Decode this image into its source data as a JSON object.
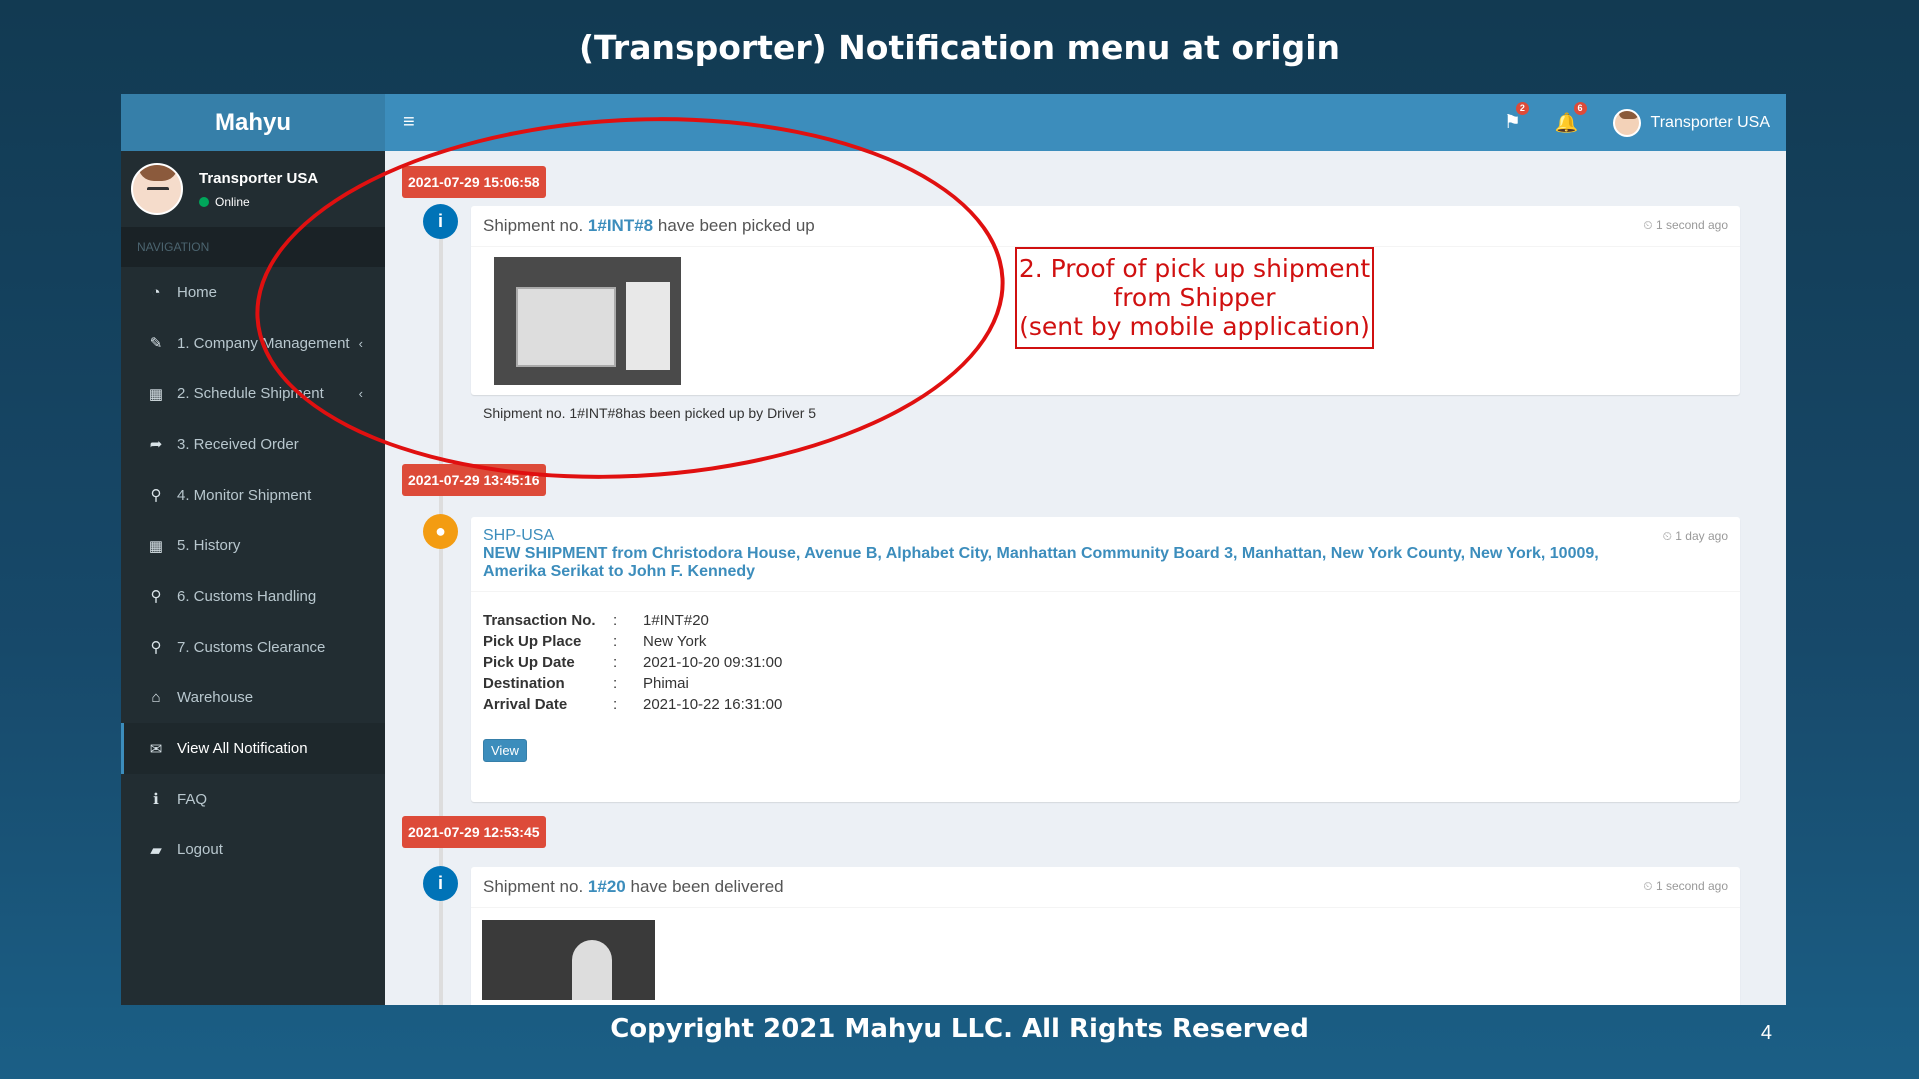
{
  "slide": {
    "title": "(Transporter) Notification menu at origin",
    "footer": "Copyright 2021 Mahyu LLC. All Rights Reserved",
    "page_number": "4"
  },
  "topbar": {
    "logo": "Mahyu",
    "flag_count": "2",
    "bell_count": "6",
    "user_name": "Transporter USA"
  },
  "sidebar": {
    "user_name": "Transporter USA",
    "status": "Online",
    "nav_header": "NAVIGATION",
    "items": [
      {
        "label": "Home",
        "icon": "dashboard-icon"
      },
      {
        "label": "1. Company Management",
        "icon": "edit-icon"
      },
      {
        "label": "2. Schedule Shipment",
        "icon": "calendar-icon"
      },
      {
        "label": "3. Received Order",
        "icon": "share-icon"
      },
      {
        "label": "4. Monitor Shipment",
        "icon": "search-icon"
      },
      {
        "label": "5. History",
        "icon": "calendar-icon"
      },
      {
        "label": "6. Customs Handling",
        "icon": "search-icon"
      },
      {
        "label": "7. Customs Clearance",
        "icon": "search-icon"
      },
      {
        "label": "Warehouse",
        "icon": "warehouse-icon"
      },
      {
        "label": "View All Notification",
        "icon": "envelope-icon"
      },
      {
        "label": "FAQ",
        "icon": "info-icon"
      },
      {
        "label": "Logout",
        "icon": "book-icon"
      }
    ]
  },
  "timeline": {
    "entries": [
      {
        "time_label": "2021-07-29 15:06:58",
        "head_prefix": "Shipment no.",
        "head_link": "1#INT#8",
        "head_suffix": "have been picked up",
        "ago": "1 second ago",
        "body_text": "Shipment no. 1#INT#8has been picked up by Driver 5"
      },
      {
        "time_label": "2021-07-29 13:45:16",
        "sender": "SHP-USA",
        "message": "NEW SHIPMENT from Christodora House, Avenue B, Alphabet City, Manhattan Community Board 3, Manhattan, New York County, New York, 10009, Amerika Serikat to John F. Kennedy",
        "ago": "1 day ago",
        "details": [
          {
            "key": "Transaction No.",
            "value": "1#INT#20"
          },
          {
            "key": "Pick Up Place",
            "value": "New York"
          },
          {
            "key": "Pick Up Date",
            "value": "2021-10-20 09:31:00"
          },
          {
            "key": "Destination",
            "value": "Phimai"
          },
          {
            "key": "Arrival Date",
            "value": "2021-10-22 16:31:00"
          }
        ],
        "separator": ":",
        "button": "View"
      },
      {
        "time_label": "2021-07-29 12:53:45",
        "head_prefix": "Shipment no.",
        "head_link": "1#20",
        "head_suffix": "have been delivered",
        "ago": "1 second ago"
      }
    ]
  },
  "annotation": {
    "line1": "2. Proof of pick up shipment",
    "line2": "from Shipper",
    "line3": "(sent by mobile application)"
  },
  "colors": {
    "topbar": "#3c8dbc",
    "sidebar": "#222d32",
    "time_label": "#dd4b39",
    "annotation": "#e01010"
  }
}
